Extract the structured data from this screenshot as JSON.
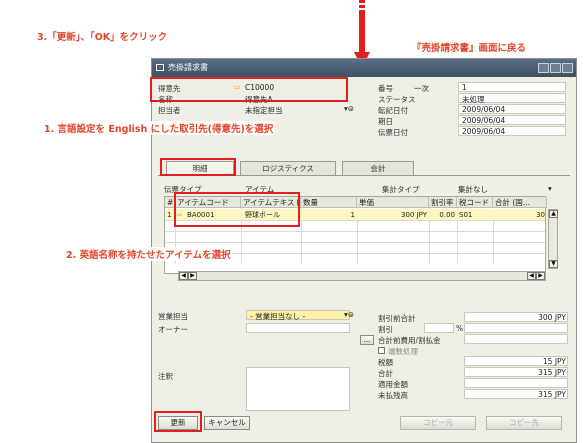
{
  "annotations": {
    "step3": "3.「更新」、「OK」をクリック",
    "back": "『売掛請求書』画面に戻る",
    "step1": "1. 言語設定を English にした取引先(得意先)を選択",
    "step2": "2. 英語名称を持たせたアイテムを選択"
  },
  "window": {
    "title": "売掛請求書"
  },
  "header_left": {
    "customer_label": "得意先",
    "customer_value": "C10000",
    "name_label": "名称",
    "name_value": "得意先A",
    "contact_label": "担当者",
    "contact_value": "未指定担当"
  },
  "header_right": {
    "number_label": "番号",
    "number_series": "一次",
    "number_value": "1",
    "status_label": "ステータス",
    "status_value": "未処理",
    "posting_label": "転記日付",
    "posting_value": "2009/06/04",
    "due_label": "期日",
    "due_value": "2009/06/04",
    "doc_date_label": "伝票日付",
    "doc_date_value": "2009/06/04"
  },
  "tabs": [
    "明細",
    "ロジスティクス",
    "会計"
  ],
  "doc_type": {
    "label": "伝票タイプ",
    "value": "アイテム",
    "summary_label": "集計タイプ",
    "summary_value": "集計なし"
  },
  "grid": {
    "columns": [
      "#",
      "アイテムコード",
      "アイテムテキスト",
      "数量",
      "単価",
      "割引率",
      "税コード",
      "合計 (国..."
    ],
    "rows": [
      {
        "num": "1",
        "code": "BA0001",
        "text": "野球ボール",
        "qty": "1",
        "price": "300 JPY",
        "discount": "0.00",
        "tax": "S01",
        "total": "30"
      }
    ]
  },
  "footer_left": {
    "sales_rep_label": "営業担当",
    "sales_rep_value": "- 営業担当なし -",
    "owner_label": "オーナー",
    "remarks_label": "注釈"
  },
  "footer_right": {
    "pre_discount_label": "割引前合計",
    "pre_discount_value": "300 JPY",
    "discount_label": "割引",
    "discount_pct": "%",
    "freight_label": "合計前費用/割払金",
    "rounding_label": "端数処理",
    "tax_label": "税額",
    "tax_value": "15 JPY",
    "total_label": "合計",
    "total_value": "315 JPY",
    "applied_label": "適用金額",
    "balance_label": "未払残高",
    "balance_value": "315 JPY"
  },
  "buttons": {
    "update": "更新",
    "cancel": "キャンセル",
    "copy_from": "コピー元",
    "copy_to": "コピー先"
  },
  "colors": {
    "annotation": "#e1462a",
    "highlight_box": "#e02020",
    "arrow": "#e02020",
    "row_highlight": "#fff7c0"
  }
}
